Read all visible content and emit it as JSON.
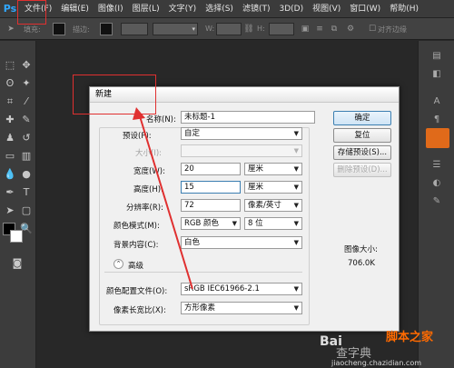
{
  "app": {
    "logo": "Ps"
  },
  "menu": [
    "文件(F)",
    "编辑(E)",
    "图像(I)",
    "图层(L)",
    "文字(Y)",
    "选择(S)",
    "滤镜(T)",
    "3D(D)",
    "视图(V)",
    "窗口(W)",
    "帮助(H)"
  ],
  "options_bar": {
    "fill_label": "填充:",
    "stroke_label": "描边:",
    "w_label": "W:",
    "h_label": "H:",
    "align_edges": "对齐边缘"
  },
  "dialog": {
    "title": "新建",
    "name_label": "名称(N):",
    "name_value": "未标题-1",
    "preset_label": "预设(P):",
    "preset_value": "自定",
    "size_label": "大小(I):",
    "width_label": "宽度(W):",
    "width_value": "20",
    "width_unit": "厘米",
    "height_label": "高度(H):",
    "height_value": "15",
    "height_unit": "厘米",
    "resolution_label": "分辨率(R):",
    "resolution_value": "72",
    "resolution_unit": "像素/英寸",
    "color_mode_label": "颜色模式(M):",
    "color_mode_value": "RGB 颜色",
    "bit_depth_value": "8 位",
    "background_label": "背景内容(C):",
    "background_value": "白色",
    "advanced_label": "高级",
    "color_profile_label": "颜色配置文件(O):",
    "color_profile_value": "sRGB IEC61966-2.1",
    "pixel_aspect_label": "像素长宽比(X):",
    "pixel_aspect_value": "方形像素",
    "ok_button": "确定",
    "reset_button": "复位",
    "save_preset_button": "存储预设(S)...",
    "delete_preset_button": "删除预设(D)...",
    "image_size_label": "图像大小:",
    "image_size_value": "706.0K"
  },
  "watermarks": {
    "baidu": "Bai",
    "chazi": "查字典",
    "site": "脚本之家",
    "url": "jiaocheng.chazidian.com"
  },
  "colors": {
    "annotation": "#e03030",
    "ok_border": "#3c7fb1",
    "menu_bg": "#3b3b3b",
    "workspace": "#282828"
  }
}
